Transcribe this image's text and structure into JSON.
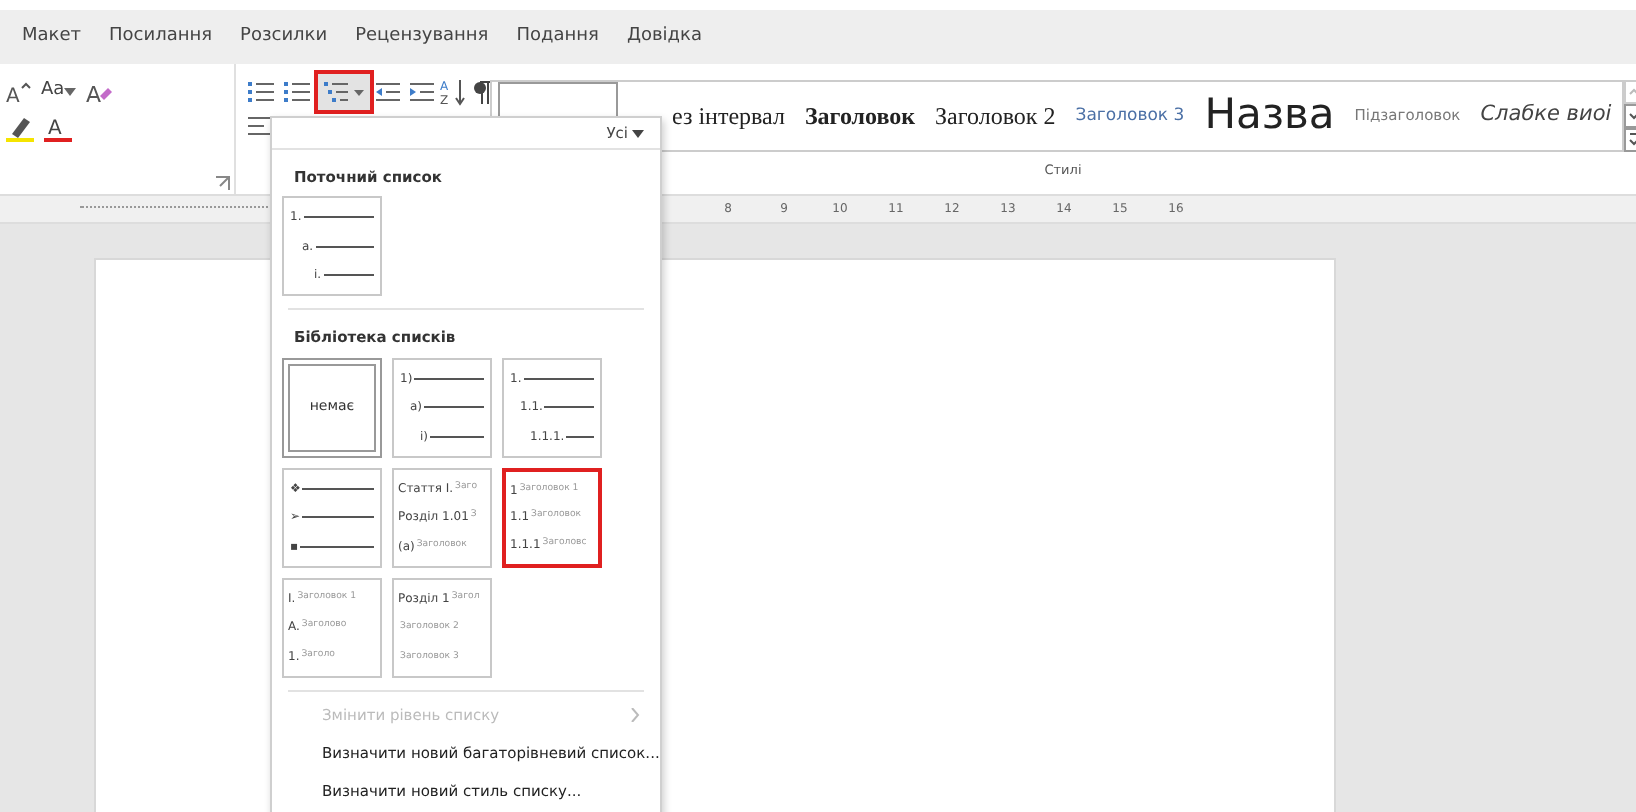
{
  "menu_tabs": [
    "Макет",
    "Посилання",
    "Розсилки",
    "Рецензування",
    "Подання",
    "Довідка"
  ],
  "ribbon": {
    "font_case_label": "Aa",
    "icon_letters": {
      "grow_font": "A",
      "clear_formatting": "A",
      "font_color": "A",
      "sort_top": "A",
      "sort_bottom": "Z"
    },
    "multilevel_button": {
      "highlighted": true
    },
    "styles": [
      {
        "label": "ез інтервал",
        "kind": "serif"
      },
      {
        "label": "Заголовок",
        "kind": "heading1"
      },
      {
        "label": "Заголовок 2",
        "kind": "heading2"
      },
      {
        "label": "Заголовок 3",
        "kind": "heading3"
      },
      {
        "label": "Назва",
        "kind": "title"
      },
      {
        "label": "Підзаголовок",
        "kind": "subtitle"
      },
      {
        "label": "Слабке виоі",
        "kind": "emphasis"
      }
    ],
    "styles_group_label": "Стилі"
  },
  "ruler": {
    "numbers": [
      "8",
      "9",
      "10",
      "11",
      "12",
      "13",
      "14",
      "15",
      "16"
    ]
  },
  "dropdown": {
    "filter": "Усі",
    "current_list_title": "Поточний список",
    "current_list": [
      {
        "marker": "1."
      },
      {
        "marker": "a."
      },
      {
        "marker": "i."
      }
    ],
    "library_title": "Бібліотека списків",
    "library": [
      {
        "kind": "none",
        "label": "немає",
        "selected": true,
        "highlighted": false
      },
      {
        "kind": "levels",
        "selected": false,
        "highlighted": false,
        "lines": [
          {
            "marker": "1)"
          },
          {
            "marker": "a)"
          },
          {
            "marker": "i)"
          }
        ]
      },
      {
        "kind": "levels",
        "selected": false,
        "highlighted": false,
        "lines": [
          {
            "marker": "1."
          },
          {
            "marker": "1.1."
          },
          {
            "marker": "1.1.1."
          }
        ]
      },
      {
        "kind": "bullets",
        "selected": false,
        "highlighted": false,
        "lines": [
          {
            "marker": "❖"
          },
          {
            "marker": "➢"
          },
          {
            "marker": "▪"
          }
        ]
      },
      {
        "kind": "headings",
        "selected": false,
        "highlighted": false,
        "lines": [
          {
            "marker": "Стаття I.",
            "text": "Заго"
          },
          {
            "marker": "Розділ 1.01",
            "text": "З"
          },
          {
            "marker": "(a)",
            "text": "Заголовок"
          }
        ]
      },
      {
        "kind": "headings",
        "selected": false,
        "highlighted": true,
        "lines": [
          {
            "marker": "1",
            "text": "Заголовок 1"
          },
          {
            "marker": "1.1",
            "text": "Заголовок"
          },
          {
            "marker": "1.1.1",
            "text": "Заголовс"
          }
        ]
      },
      {
        "kind": "headings",
        "selected": false,
        "highlighted": false,
        "lines": [
          {
            "marker": "I.",
            "text": "Заголовок 1"
          },
          {
            "marker": "A.",
            "text": "Заголово"
          },
          {
            "marker": "1.",
            "text": "Заголо"
          }
        ]
      },
      {
        "kind": "headings",
        "selected": false,
        "highlighted": false,
        "lines": [
          {
            "marker": "Розділ 1",
            "text": "Загол"
          },
          {
            "text": "Заголовок 2"
          },
          {
            "text": "Заголовок 3"
          }
        ]
      }
    ],
    "menu_items": [
      {
        "label": "Змінити рівень списку",
        "disabled": true,
        "submenu": true
      },
      {
        "label": "Визначити новий багаторівневий список...",
        "disabled": false,
        "submenu": false
      },
      {
        "label": "Визначити новий стиль списку...",
        "disabled": false,
        "submenu": false
      }
    ]
  }
}
